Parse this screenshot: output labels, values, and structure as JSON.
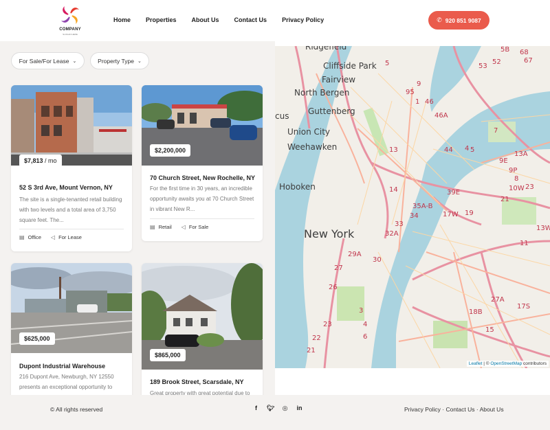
{
  "header": {
    "logo_text": "COMPANY",
    "logo_tagline": "SLOGAN HERE",
    "nav": [
      "Home",
      "Properties",
      "About Us",
      "Contact Us",
      "Privacy Policy"
    ],
    "phone": "920 851 9087"
  },
  "filters": {
    "sale_lease": "For Sale/For Lease",
    "property_type": "Property Type"
  },
  "listings": [
    {
      "price": "$7,813",
      "price_unit": " / mo",
      "title": "52 S 3rd Ave, Mount Vernon, NY",
      "description": "The site is a single-tenanted retail building with two levels and a total area of 3,750 square feet. The...",
      "type": "Office",
      "status": "For Lease"
    },
    {
      "price": "$2,200,000",
      "price_unit": "",
      "title": "70 Church Street, New Rochelle, NY",
      "description": "For the first time in 30 years, an incredible opportunity awaits you at 70 Church Street in vibrant New R...",
      "type": "Retail",
      "status": "For Sale"
    },
    {
      "price": "$625,000",
      "price_unit": "",
      "title": "Dupont Industrial Warehouse",
      "description": "216 Dupont Ave, Newburgh, NY 12550 presents an exceptional opportunity to",
      "type": "",
      "status": ""
    },
    {
      "price": "$865,000",
      "price_unit": "",
      "title": "189 Brook Street, Scarsdale, NY",
      "description": "Great property with great potential due to",
      "type": "",
      "status": ""
    }
  ],
  "map": {
    "labels": [
      "Ridgefield",
      "Cliffside Park",
      "Fairview",
      "North Bergen",
      "Guttenberg",
      "Union City",
      "Weehawken",
      "Hoboken",
      "New York",
      "cus"
    ],
    "routes": [
      "5B",
      "68",
      "67",
      "52",
      "53",
      "5",
      "9",
      "95",
      "1",
      "13",
      "46",
      "46A",
      "44",
      "4",
      "5",
      "13A",
      "9E",
      "7",
      "8",
      "9P",
      "10W",
      "23",
      "14",
      "35A-B",
      "34",
      "17W",
      "19",
      "21",
      "33",
      "32A",
      "29A",
      "30",
      "27",
      "26",
      "23",
      "22",
      "21",
      "3",
      "4",
      "6",
      "18B",
      "15",
      "17S",
      "27A",
      "11",
      "13W",
      "39E"
    ],
    "attribution_leaflet": "Leaflet",
    "attribution_sep": " | © ",
    "attribution_osm": "OpenStreetMap",
    "attribution_rest": " contributors"
  },
  "footer": {
    "copyright": "© All rights reserved",
    "social_icons": [
      "facebook-icon",
      "twitter-icon",
      "instagram-icon",
      "linkedin-icon"
    ],
    "links": [
      "Privacy Policy",
      "Contact Us",
      "About Us"
    ],
    "link_sep": " · "
  },
  "colors": {
    "accent": "#ea5b4c",
    "panel_bg": "#f4f2f0",
    "water": "#aad3df",
    "highway": "#e892a2",
    "major_road": "#f9b29c",
    "secondary_road": "#fcd6a4"
  }
}
